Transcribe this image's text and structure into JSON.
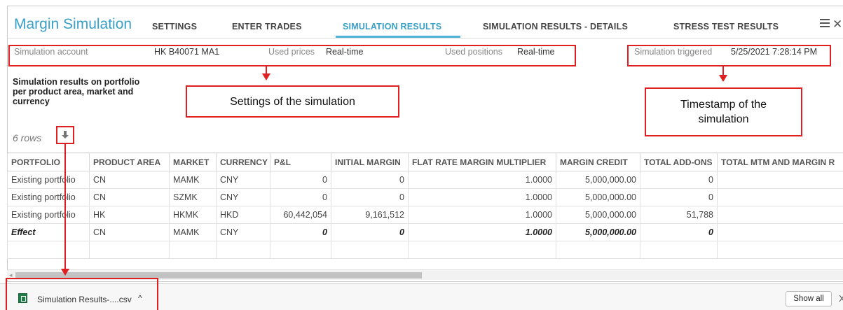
{
  "app": {
    "title": "Margin Simulation"
  },
  "tabs": [
    {
      "label": "SETTINGS",
      "active": false
    },
    {
      "label": "ENTER TRADES",
      "active": false
    },
    {
      "label": "SIMULATION RESULTS",
      "active": true
    },
    {
      "label": "SIMULATION RESULTS - DETAILS",
      "active": false
    },
    {
      "label": "STRESS TEST RESULTS",
      "active": false
    }
  ],
  "settings": {
    "account_label": "Simulation account",
    "account_value": "HK B40071 MA1",
    "prices_label": "Used prices",
    "prices_value": "Real-time",
    "positions_label": "Used positions",
    "positions_value": "Real-time",
    "triggered_label": "Simulation triggered",
    "triggered_value": "5/25/2021 7:28:14 PM"
  },
  "annotations": {
    "settings_callout": "Settings of the simulation",
    "timestamp_callout_line1": "Timestamp of the",
    "timestamp_callout_line2": "simulation"
  },
  "section": {
    "title": "Simulation results on portfolio per product area, market and currency",
    "rows_count": "6 rows"
  },
  "table": {
    "columns": [
      "PORTFOLIO",
      "PRODUCT AREA",
      "MARKET",
      "CURRENCY",
      "P&L",
      "INITIAL MARGIN",
      "FLAT RATE MARGIN MULTIPLIER",
      "MARGIN CREDIT",
      "TOTAL ADD-ONS",
      "TOTAL MTM AND MARGIN R"
    ],
    "rows": [
      [
        "Existing portfolio",
        "CN",
        "MAMK",
        "CNY",
        "0",
        "0",
        "1.0000",
        "5,000,000.00",
        "0",
        ""
      ],
      [
        "Existing portfolio",
        "CN",
        "SZMK",
        "CNY",
        "0",
        "0",
        "1.0000",
        "5,000,000.00",
        "0",
        ""
      ],
      [
        "Existing portfolio",
        "HK",
        "HKMK",
        "HKD",
        "60,442,054",
        "9,161,512",
        "1.0000",
        "5,000,000.00",
        "51,788",
        ""
      ],
      [
        "Effect",
        "CN",
        "MAMK",
        "CNY",
        "0",
        "0",
        "1.0000",
        "5,000,000.00",
        "0",
        ""
      ]
    ]
  },
  "download_bar": {
    "file_name": "Simulation Results-....csv",
    "show_all_label": "Show all",
    "caret": "^",
    "close": "X"
  },
  "colors": {
    "accent": "#3a9fc8",
    "annotation": "#e02020"
  }
}
